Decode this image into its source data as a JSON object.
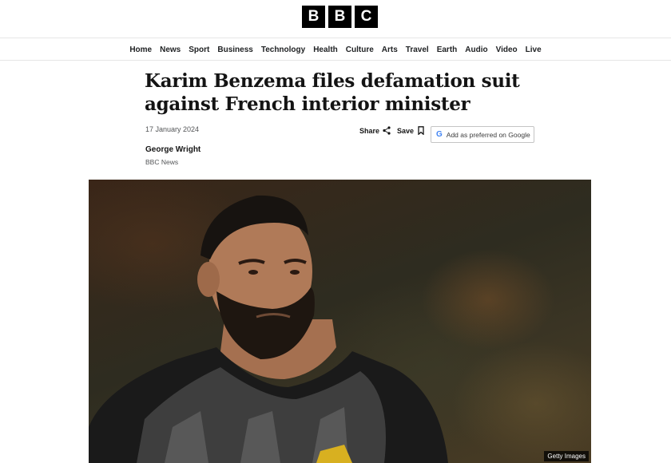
{
  "logo": {
    "letters": [
      "B",
      "B",
      "C"
    ]
  },
  "nav": {
    "items": [
      "Home",
      "News",
      "Sport",
      "Business",
      "Technology",
      "Health",
      "Culture",
      "Arts",
      "Travel",
      "Earth",
      "Audio",
      "Video",
      "Live"
    ]
  },
  "article": {
    "headline": "Karim Benzema files defamation suit against French interior minister",
    "date": "17 January 2024",
    "author": "George Wright",
    "organization": "BBC News"
  },
  "actions": {
    "share_label": "Share",
    "save_label": "Save",
    "google_label": "Add as preferred on Google",
    "google_icon": "G"
  },
  "image": {
    "credit": "Getty Images"
  }
}
